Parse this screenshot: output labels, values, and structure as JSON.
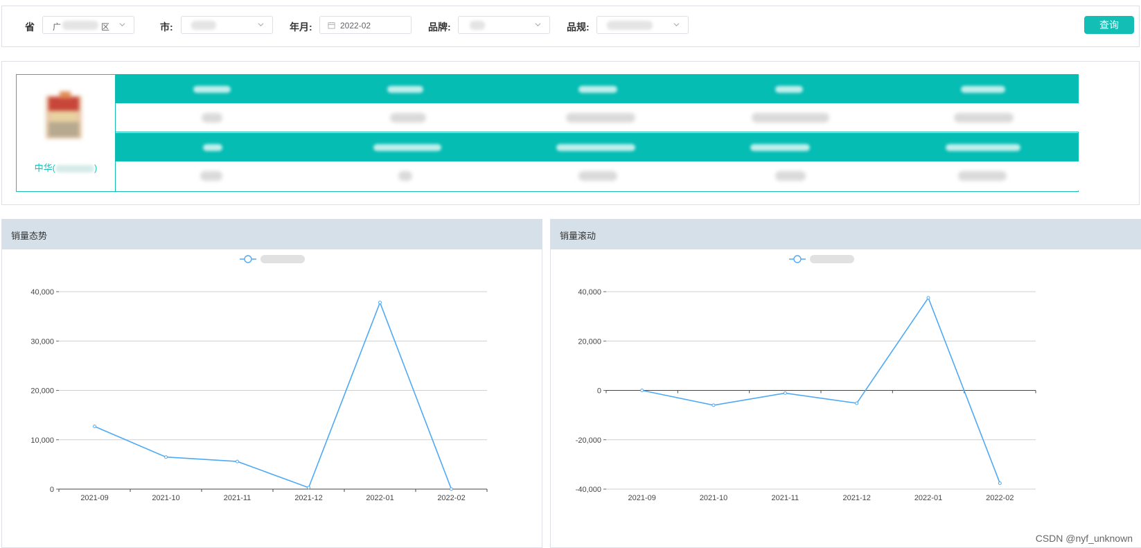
{
  "filters": {
    "province_label": "省",
    "province_value": "广",
    "province_suffix": "区",
    "city_label": "市:",
    "city_value": "",
    "month_label": "年月:",
    "month_value": "2022-02",
    "brand_label": "品牌:",
    "brand_value": "",
    "spec_label": "品规:",
    "spec_value": "",
    "query_button": "查询"
  },
  "info": {
    "brand_name_prefix": "中华(",
    "brand_name_suffix": ")"
  },
  "charts": [
    {
      "title": "销量态势",
      "chart_data": {
        "type": "line",
        "categories": [
          "2021-09",
          "2021-10",
          "2021-11",
          "2021-12",
          "2022-01",
          "2022-02"
        ],
        "series": [
          {
            "values": [
              12700,
              6500,
              5600,
              300,
              37800,
              0
            ]
          }
        ],
        "ylim": [
          0,
          40000
        ],
        "yticks": [
          0,
          10000,
          20000,
          30000,
          40000
        ],
        "ytick_labels": [
          "0",
          "10,000",
          "20,000",
          "30,000",
          "40,000"
        ],
        "grid": true,
        "legend": "top-center",
        "color": "#4ea9f5"
      }
    },
    {
      "title": "销量滚动",
      "chart_data": {
        "type": "line",
        "categories": [
          "2021-09",
          "2021-10",
          "2021-11",
          "2021-12",
          "2022-01",
          "2022-02"
        ],
        "series": [
          {
            "values": [
              0,
              -6000,
              -1100,
              -5200,
              37500,
              -37600
            ]
          }
        ],
        "ylim": [
          -40000,
          40000
        ],
        "yticks": [
          -40000,
          -20000,
          0,
          20000,
          40000
        ],
        "ytick_labels": [
          "-40,000",
          "-20,000",
          "0",
          "20,000",
          "40,000"
        ],
        "grid": true,
        "legend": "top-center",
        "color": "#4ea9f5"
      }
    }
  ],
  "watermark": "CSDN @nyf_unknown"
}
